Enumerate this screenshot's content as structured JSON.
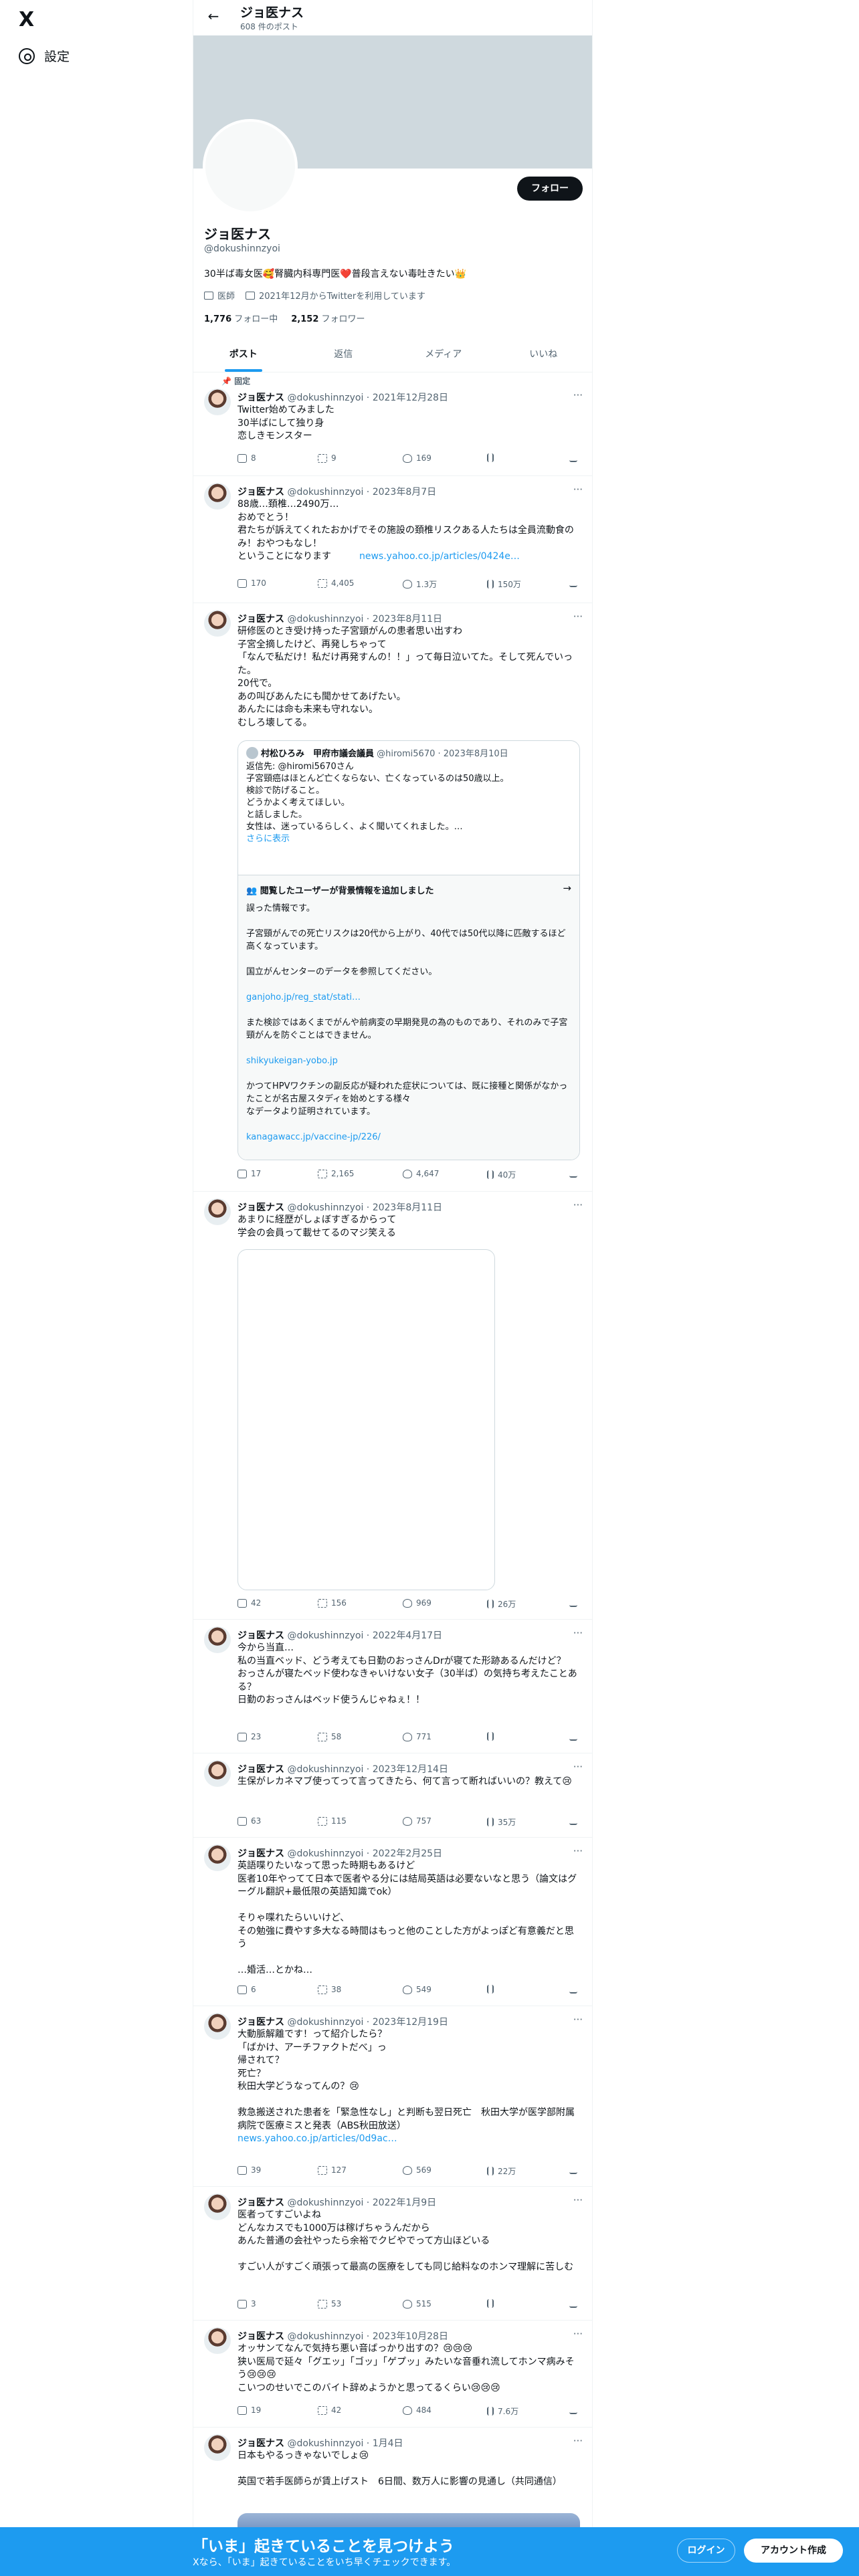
{
  "sidebar": {
    "logo": "X",
    "settings_label": "設定"
  },
  "header": {
    "name": "ジョ医ナス",
    "post_count": "608 件のポスト"
  },
  "profile": {
    "follow_label": "フォロー",
    "name": "ジョ医ナス",
    "handle": "@dokushinnzyoi",
    "bio": "30半ば毒女医🥰腎臓内科専門医❤️普段言えない毒吐きたい👑",
    "job": "医師",
    "joined": "2021年12月からTwitterを利用しています",
    "following_count": "1,776",
    "following_label": " フォロー中",
    "followers_count": "2,152",
    "followers_label": " フォロワー"
  },
  "tabs": [
    "ポスト",
    "返信",
    "メディア",
    "いいね"
  ],
  "pinned_label": "固定",
  "tweets": [
    {
      "name": "ジョ医ナス",
      "meta": " @dokushinnzyoi · 2021年12月28日",
      "text": "Twitter始めてみました\n30半ばにして独り身\n恋しきモンスター",
      "reply": "8",
      "retweet": "9",
      "like": "169",
      "views": ""
    },
    {
      "name": "ジョ医ナス",
      "meta": " @dokushinnzyoi · 2023年8月7日",
      "text": "88歳…頚椎…2490万…\nおめでとう！\n君たちが訴えてくれたおかげでその施設の頚椎リスクある人たちは全員流動食のみ！おやつもなし！\nということになります",
      "link": "news.yahoo.co.jp/articles/0424e…",
      "reply": "170",
      "retweet": "4,405",
      "like": "1.3万",
      "views": "150万"
    },
    {
      "name": "ジョ医ナス",
      "meta": " @dokushinnzyoi · 2023年8月11日",
      "text": "研修医のとき受け持った子宮頸がんの患者思い出すわ\n子宮全摘したけど、再発しちゃって\n「なんで私だけ！私だけ再発すんの！！」って毎日泣いてた。そして死んでいった。\n20代で。\nあの叫びあんたにも聞かせてあげたい。\nあんたには命も未来も守れない。\nむしろ壊してる。",
      "quote": {
        "name": "村松ひろみ　甲府市議会議員",
        "meta": " @hiromi5670 · 2023年8月10日",
        "text": "返信先: @hiromi5670さん\n子宮頸癌はほとんど亡くならない、亡くなっているのは50歳以上。\n検診で防げること。\nどうかよく考えてほしい。\nと話しました。\n女性は、迷っているらしく、よく聞いてくれました。…",
        "more": "さらに表示",
        "note_title": "閲覧したユーザーが背景情報を追加しました",
        "note_text": "誤った情報です。\n\n子宮頸がんでの死亡リスクは20代から上がり、40代では50代以降に匹敵するほど高くなっています。\n\n国立がんセンターのデータを参照してください。",
        "note_link1": "ganjoho.jp/reg_stat/stati…",
        "note_text2": "また検診ではあくまでがんや前病変の早期発見の為のものであり、それのみで子宮頸がんを防ぐことはできません。",
        "note_link2": "shikyukeigan-yobo.jp",
        "note_text3": "かつてHPVワクチンの副反応が疑われた症状については、既に接種と関係がなかったことが名古屋スタディを始めとする様々\nなデータより証明されています。",
        "note_link3": "kanagawacc.jp/vaccine-jp/226/"
      },
      "reply": "17",
      "retweet": "2,165",
      "like": "4,647",
      "views": "40万"
    },
    {
      "name": "ジョ医ナス",
      "meta": " @dokushinnzyoi · 2023年8月11日",
      "text": "あまりに経歴がしょぼすぎるからって\n学会の会員って載せてるのマジ笑える",
      "reply": "42",
      "retweet": "156",
      "like": "969",
      "views": "26万"
    },
    {
      "name": "ジョ医ナス",
      "meta": " @dokushinnzyoi · 2022年4月17日",
      "text": "今から当直…\n私の当直ベッド、どう考えても日勤のおっさんDrが寝てた形跡あるんだけど？\nおっさんが寝たベッド使わなきゃいけない女子（30半ば）の気持ち考えたことある？\n日勤のおっさんはベッド使うんじゃねぇ！！",
      "reply": "23",
      "retweet": "58",
      "like": "771",
      "views": ""
    },
    {
      "name": "ジョ医ナス",
      "meta": " @dokushinnzyoi · 2023年12月14日",
      "text": "生保がレカネマブ使ってって言ってきたら、何て言って断ればいいの？教えて😢",
      "reply": "63",
      "retweet": "115",
      "like": "757",
      "views": "35万"
    },
    {
      "name": "ジョ医ナス",
      "meta": " @dokushinnzyoi · 2022年2月25日",
      "text": "英語喋りたいなって思った時期もあるけど\n医者10年やってて日本で医者やる分には結局英語は必要ないなと思う（論文はグーグル翻訳+最低限の英語知識でok）\n\nそりゃ喋れたらいいけど、\nその勉強に費やす多大なる時間はもっと他のことした方がよっぽど有意義だと思う\n\n…婚活…とかね…",
      "reply": "6",
      "retweet": "38",
      "like": "549",
      "views": ""
    },
    {
      "name": "ジョ医ナス",
      "meta": " @dokushinnzyoi · 2023年12月19日",
      "text": "大動脈解離です！って紹介したら？\n「ばかけ、アーチファクトだべ」っ\n帰されて？\n死亡？\n秋田大学どうなってんの？😢\n\n救急搬送された患者を「緊急性なし」と判断も翌日死亡　秋田大学が医学部附属病院で医療ミスと発表（ABS秋田放送）",
      "link": "news.yahoo.co.jp/articles/0d9ac…",
      "reply": "39",
      "retweet": "127",
      "like": "569",
      "views": "22万"
    },
    {
      "name": "ジョ医ナス",
      "meta": " @dokushinnzyoi · 2022年1月9日",
      "text": "医者ってすごいよね\nどんなカスでも1000万は稼げちゃうんだから\nあんた普通の会社やったら余裕でクビやでって方山ほどいる\n\nすごい人がすごく頑張って最高の医療をしても同じ給料なのホンマ理解に苦しむ",
      "reply": "3",
      "retweet": "53",
      "like": "515",
      "views": ""
    },
    {
      "name": "ジョ医ナス",
      "meta": " @dokushinnzyoi · 2023年10月28日",
      "text": "オッサンてなんで気持ち悪い音ばっかり出すの？😢😢😢\n狭い医局で延々「グエッ」「ゴッ」「ゲプッ」みたいな音垂れ流してホンマ病みそう😢😢😢\nこいつのせいでこのバイト辞めようかと思ってるくらい😢😢😢",
      "reply": "19",
      "retweet": "42",
      "like": "484",
      "views": "7.6万"
    },
    {
      "name": "ジョ医ナス",
      "meta": " @dokushinnzyoi · 1月4日",
      "text": "日本もやるっきゃないでしょ😢\n\n英国で若手医師らが賃上げスト　6日間、数万人に影響の見通し（共同通信）"
    }
  ],
  "bottom_banner": {
    "title": "「いま」起きていることを見つけよう",
    "subtitle": "Xなら、「いま」起きていることをいち早くチェックできます。",
    "login": "ログイン",
    "signup": "アカウント作成"
  }
}
